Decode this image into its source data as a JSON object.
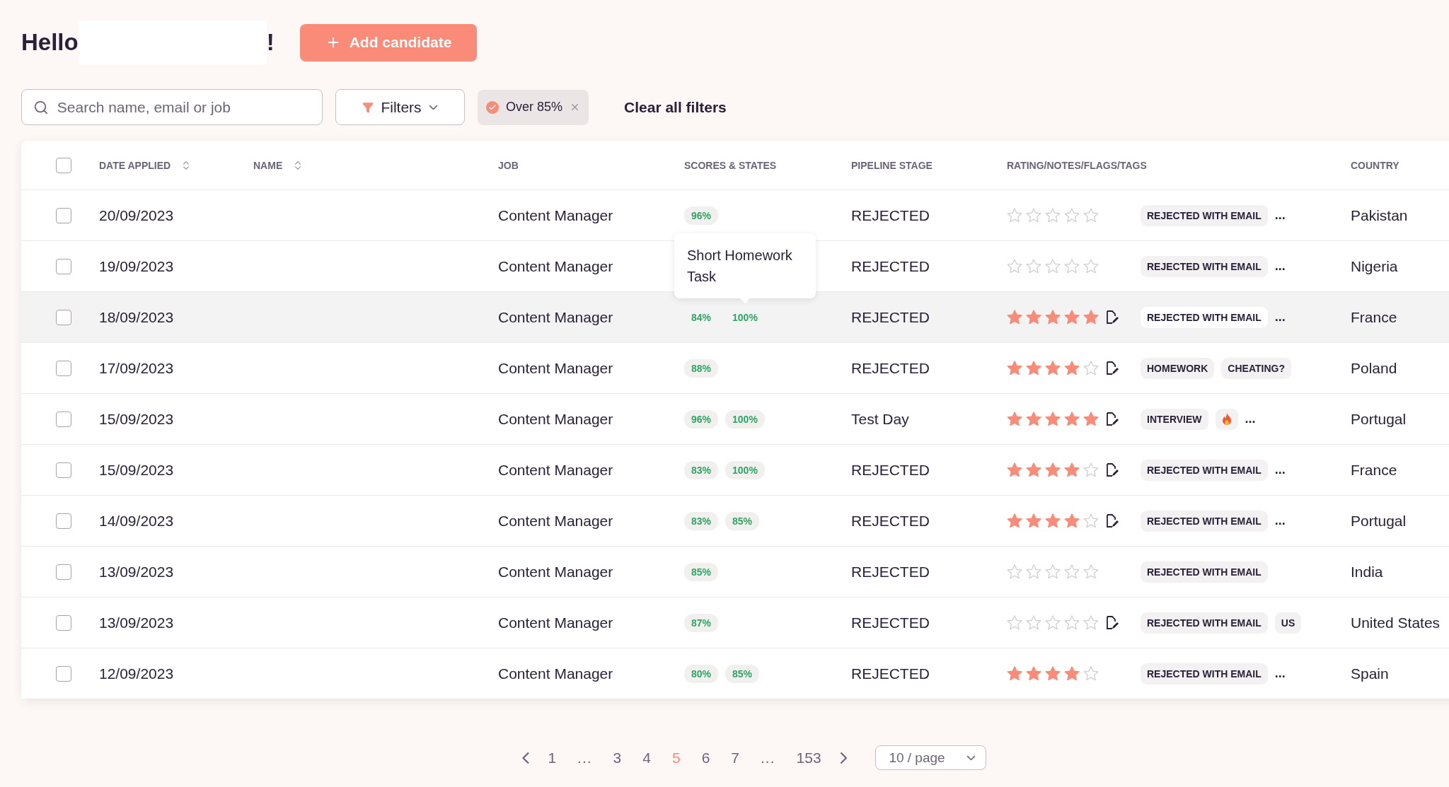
{
  "greeting": {
    "prefix": "Hello",
    "suffix": "!"
  },
  "add_button": {
    "label": "Add candidate"
  },
  "search": {
    "placeholder": "Search name, email or job"
  },
  "filters_button": {
    "label": "Filters"
  },
  "active_filter": {
    "label": "Over 85%"
  },
  "clear_filters": {
    "label": "Clear all filters"
  },
  "table": {
    "select_all": {
      "checked": false
    },
    "columns": [
      {
        "label": "DATE APPLIED",
        "sortable": true
      },
      {
        "label": "NAME",
        "sortable": true
      },
      {
        "label": "JOB",
        "sortable": false
      },
      {
        "label": "SCORES & STATES",
        "sortable": false
      },
      {
        "label": "PIPELINE STAGE",
        "sortable": false
      },
      {
        "label": "RATING/NOTES/FLAGS/TAGS",
        "sortable": false
      },
      {
        "label": "COUNTRY",
        "sortable": false
      }
    ],
    "rows": [
      {
        "checked": false,
        "highlighted": false,
        "date": "20/09/2023",
        "job": "Content Manager",
        "scores": [
          {
            "text": "96%"
          }
        ],
        "stage": "REJECTED",
        "stars": 0,
        "note": false,
        "tags": [
          {
            "kind": "label",
            "text": "REJECTED WITH EMAIL"
          }
        ],
        "more": "...",
        "country": "Pakistan"
      },
      {
        "checked": false,
        "highlighted": false,
        "date": "19/09/2023",
        "job": "Content Manager",
        "scores": [],
        "stage": "REJECTED",
        "stars": 0,
        "note": false,
        "tags": [
          {
            "kind": "label",
            "text": "REJECTED WITH EMAIL"
          }
        ],
        "more": "...",
        "country": "Nigeria"
      },
      {
        "checked": false,
        "highlighted": true,
        "date": "18/09/2023",
        "job": "Content Manager",
        "scores": [
          {
            "text": "84%"
          },
          {
            "text": "100%",
            "tooltip": "Short Homework Task"
          }
        ],
        "stage": "REJECTED",
        "stars": 5,
        "note": true,
        "tags": [
          {
            "kind": "label",
            "text": "REJECTED WITH EMAIL"
          }
        ],
        "more": "...",
        "country": "France"
      },
      {
        "checked": false,
        "highlighted": false,
        "date": "17/09/2023",
        "job": "Content Manager",
        "scores": [
          {
            "text": "88%"
          }
        ],
        "stage": "REJECTED",
        "stars": 4,
        "note": true,
        "tags": [
          {
            "kind": "label",
            "text": "HOMEWORK"
          },
          {
            "kind": "label",
            "text": "CHEATING?"
          }
        ],
        "country": "Poland"
      },
      {
        "checked": false,
        "highlighted": false,
        "date": "15/09/2023",
        "job": "Content Manager",
        "scores": [
          {
            "text": "96%"
          },
          {
            "text": "100%"
          }
        ],
        "stage": "Test Day",
        "stars": 5,
        "note": true,
        "tags": [
          {
            "kind": "label",
            "text": "INTERVIEW"
          },
          {
            "kind": "flame"
          },
          {
            "kind": "more",
            "text": "..."
          }
        ],
        "country": "Portugal"
      },
      {
        "checked": false,
        "highlighted": false,
        "date": "15/09/2023",
        "job": "Content Manager",
        "scores": [
          {
            "text": "83%"
          },
          {
            "text": "100%"
          }
        ],
        "stage": "REJECTED",
        "stars": 4,
        "note": true,
        "tags": [
          {
            "kind": "label",
            "text": "REJECTED WITH EMAIL"
          }
        ],
        "more": "...",
        "country": "France"
      },
      {
        "checked": false,
        "highlighted": false,
        "date": "14/09/2023",
        "job": "Content Manager",
        "scores": [
          {
            "text": "83%"
          },
          {
            "text": "85%"
          }
        ],
        "stage": "REJECTED",
        "stars": 4,
        "note": true,
        "tags": [
          {
            "kind": "label",
            "text": "REJECTED WITH EMAIL"
          }
        ],
        "more": "...",
        "country": "Portugal"
      },
      {
        "checked": false,
        "highlighted": false,
        "date": "13/09/2023",
        "job": "Content Manager",
        "scores": [
          {
            "text": "85%"
          }
        ],
        "stage": "REJECTED",
        "stars": 0,
        "note": false,
        "tags": [
          {
            "kind": "label",
            "text": "REJECTED WITH EMAIL"
          }
        ],
        "country": "India"
      },
      {
        "checked": false,
        "highlighted": false,
        "date": "13/09/2023",
        "job": "Content Manager",
        "scores": [
          {
            "text": "87%"
          }
        ],
        "stage": "REJECTED",
        "stars": 0,
        "note": true,
        "tags": [
          {
            "kind": "label",
            "text": "REJECTED WITH EMAIL"
          },
          {
            "kind": "label",
            "text": "US"
          }
        ],
        "country": "United States"
      },
      {
        "checked": false,
        "highlighted": false,
        "date": "12/09/2023",
        "job": "Content Manager",
        "scores": [
          {
            "text": "80%"
          },
          {
            "text": "85%"
          }
        ],
        "stage": "REJECTED",
        "stars": 4,
        "note": false,
        "tags": [
          {
            "kind": "label",
            "text": "REJECTED WITH EMAIL"
          }
        ],
        "more": "...",
        "country": "Spain"
      }
    ]
  },
  "pagination": {
    "pages": [
      {
        "kind": "page",
        "text": "1",
        "selected": false
      },
      {
        "kind": "ellipsis",
        "text": "...",
        "selected": false
      },
      {
        "kind": "page",
        "text": "3",
        "selected": false
      },
      {
        "kind": "page",
        "text": "4",
        "selected": false
      },
      {
        "kind": "page",
        "text": "5",
        "selected": true
      },
      {
        "kind": "page",
        "text": "6",
        "selected": false
      },
      {
        "kind": "page",
        "text": "7",
        "selected": false
      },
      {
        "kind": "ellipsis",
        "text": "...",
        "selected": false
      },
      {
        "kind": "page",
        "text": "153",
        "selected": false
      }
    ],
    "page_size": "10 / page"
  }
}
